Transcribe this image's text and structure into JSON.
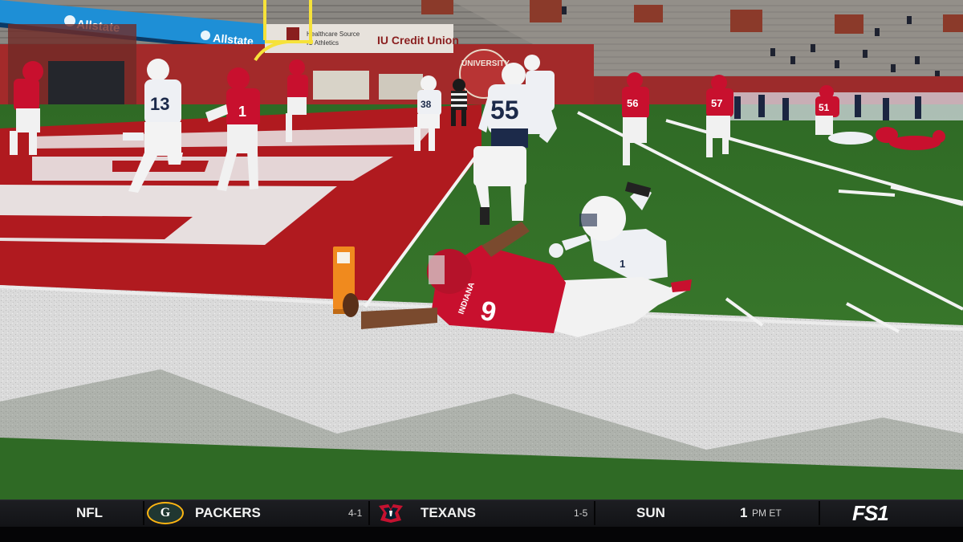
{
  "scene": {
    "banner_text": "Allstate",
    "banner_logo": "motorola-logo",
    "wall_sign_text": "IU Credit Union",
    "wall_sign_small": "Healthcare Source",
    "wall_sign_small2": "IU Athletics",
    "wall_logo_text": "UNIVERSITY",
    "player_numbers": {
      "runner": "9",
      "defender_dive": "1",
      "lineman_55": "55",
      "defender_13": "13",
      "receiver_1": "1",
      "player_56": "56",
      "player_57": "57",
      "player_51": "51",
      "player_38": "38"
    },
    "jersey_wordmark": "INDIANA",
    "colors": {
      "turf": "#3f7a2c",
      "endzone_red": "#b01a1f",
      "indiana_crimson": "#c8102e",
      "white_uniform": "#eef0f4",
      "penn_state_navy": "#1c2a4a"
    }
  },
  "ticker": {
    "league": "NFL",
    "team1": {
      "name": "PACKERS",
      "record": "4-1",
      "logo": "packers-g-logo"
    },
    "team2": {
      "name": "TEXANS",
      "record": "1-5",
      "logo": "texans-bull-logo"
    },
    "day": "SUN",
    "time": "1",
    "time_suffix": "PM ET",
    "network": "FS1"
  }
}
